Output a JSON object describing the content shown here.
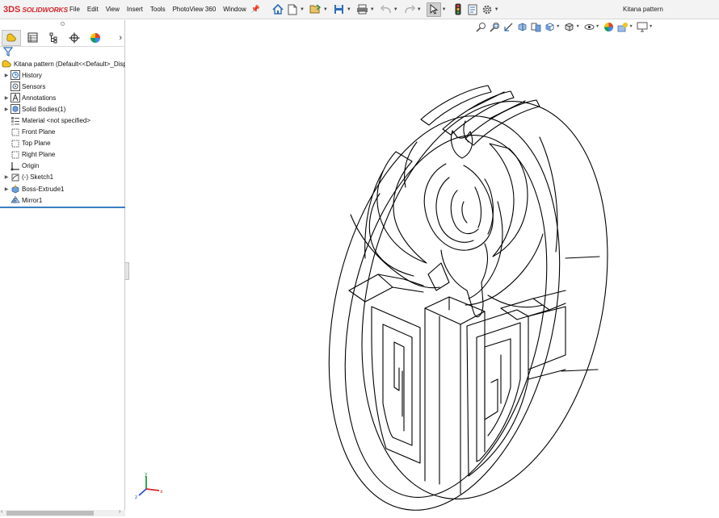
{
  "app": {
    "brand_prefix": "3DS",
    "brand": "SOLIDWORKS",
    "document_title": "Kitana pattern"
  },
  "menu": [
    "File",
    "Edit",
    "View",
    "Insert",
    "Tools",
    "PhotoView 360",
    "Window"
  ],
  "toolbar": {
    "icons": [
      "home-icon",
      "new-document-icon",
      "open-icon",
      "save-icon",
      "print-icon",
      "undo-icon",
      "redo-icon",
      "select-icon",
      "traffic-light-icon",
      "file-properties-icon",
      "options-icon"
    ]
  },
  "feature_manager": {
    "tabs": [
      "feature-manager-tab",
      "property-manager-tab",
      "configuration-manager-tab",
      "dimxpert-tab",
      "display-manager-tab"
    ],
    "root": "Kitana pattern  (Default<<Default>_Disp",
    "items": [
      {
        "label": "History",
        "icon": "history-icon",
        "expandable": true
      },
      {
        "label": "Sensors",
        "icon": "sensors-icon",
        "expandable": false
      },
      {
        "label": "Annotations",
        "icon": "annotations-icon",
        "expandable": true
      },
      {
        "label": "Solid Bodies(1)",
        "icon": "solid-bodies-icon",
        "expandable": true
      },
      {
        "label": "Material <not specified>",
        "icon": "material-icon",
        "expandable": false
      },
      {
        "label": "Front Plane",
        "icon": "plane-icon",
        "expandable": false
      },
      {
        "label": "Top Plane",
        "icon": "plane-icon",
        "expandable": false
      },
      {
        "label": "Right Plane",
        "icon": "plane-icon",
        "expandable": false
      },
      {
        "label": "Origin",
        "icon": "origin-icon",
        "expandable": false
      },
      {
        "label": "(-) Sketch1",
        "icon": "sketch-icon",
        "expandable": true
      },
      {
        "label": "Boss-Extrude1",
        "icon": "extrude-icon",
        "expandable": true
      },
      {
        "label": "Mirror1",
        "icon": "mirror-icon",
        "expandable": false
      }
    ]
  },
  "triad": {
    "x": "x",
    "y": "y",
    "z": "z"
  },
  "colors": {
    "brand": "#d4282f",
    "rollback": "#3a7fc3",
    "accent_blue": "#2f6db5"
  }
}
